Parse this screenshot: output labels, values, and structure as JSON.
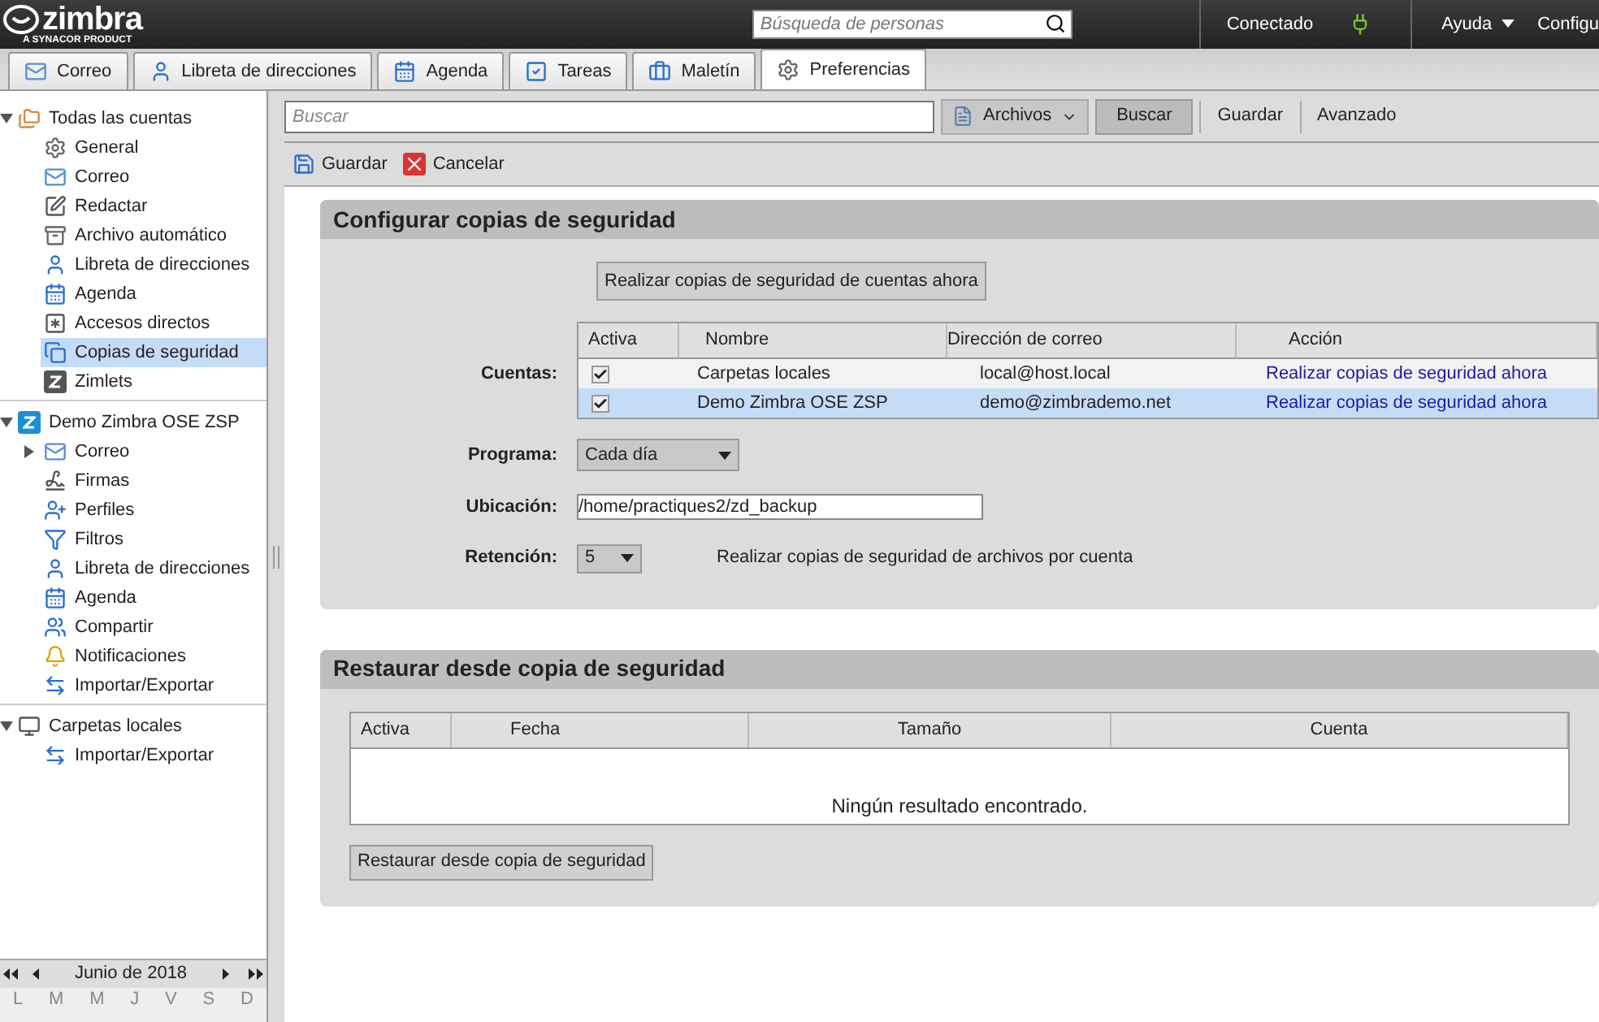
{
  "header": {
    "logo": "zimbra",
    "tagline": "A SYNACOR PRODUCT",
    "people_search": {
      "placeholder": "Búsqueda de personas"
    },
    "status": "Conectado",
    "help": "Ayuda",
    "settings": "Configu"
  },
  "tabs": [
    {
      "label": "Correo",
      "kind": "mail",
      "selected": false
    },
    {
      "label": "Libreta de direcciones",
      "kind": "contacts",
      "selected": false
    },
    {
      "label": "Agenda",
      "kind": "calendar",
      "selected": false
    },
    {
      "label": "Tareas",
      "kind": "tasks",
      "selected": false
    },
    {
      "label": "Maletín",
      "kind": "briefcase",
      "selected": false
    },
    {
      "label": "Preferencias",
      "kind": "gear",
      "selected": true
    }
  ],
  "sidebar": {
    "groups": [
      {
        "label": "Todas las cuentas",
        "kind": "accounts",
        "expanded": true,
        "children": [
          {
            "label": "General",
            "kind": "gear",
            "selected": false
          },
          {
            "label": "Correo",
            "kind": "mail",
            "selected": false
          },
          {
            "label": "Redactar",
            "kind": "compose",
            "selected": false
          },
          {
            "label": "Archivo automático",
            "kind": "archive",
            "selected": false
          },
          {
            "label": "Libreta de direcciones",
            "kind": "contacts",
            "selected": false
          },
          {
            "label": "Agenda",
            "kind": "calendar",
            "selected": false
          },
          {
            "label": "Accesos directos",
            "kind": "shortcut",
            "selected": false
          },
          {
            "label": "Copias de seguridad",
            "kind": "backup",
            "selected": true
          },
          {
            "label": "Zimlets",
            "kind": "zimlet",
            "selected": false
          }
        ]
      },
      {
        "label": "Demo Zimbra OSE ZSP",
        "kind": "zimbra",
        "expanded": true,
        "children": [
          {
            "label": "Correo",
            "kind": "mail",
            "selected": false,
            "expanded": false
          },
          {
            "label": "Firmas",
            "kind": "signature",
            "selected": false
          },
          {
            "label": "Perfiles",
            "kind": "persona",
            "selected": false
          },
          {
            "label": "Filtros",
            "kind": "filter",
            "selected": false
          },
          {
            "label": "Libreta de direcciones",
            "kind": "contacts",
            "selected": false
          },
          {
            "label": "Agenda",
            "kind": "calendar",
            "selected": false
          },
          {
            "label": "Compartir",
            "kind": "share",
            "selected": false
          },
          {
            "label": "Notificaciones",
            "kind": "bell",
            "selected": false
          },
          {
            "label": "Importar/Exportar",
            "kind": "import",
            "selected": false
          }
        ]
      },
      {
        "label": "Carpetas locales",
        "kind": "local",
        "expanded": true,
        "children": [
          {
            "label": "Importar/Exportar",
            "kind": "import",
            "selected": false
          }
        ]
      }
    ]
  },
  "mini_calendar": {
    "title": "Junio de 2018",
    "weekdays": [
      "L",
      "M",
      "M",
      "J",
      "V",
      "S",
      "D"
    ]
  },
  "search_bar": {
    "placeholder": "Buscar",
    "scope": "Archivos",
    "search": "Buscar",
    "save": "Guardar",
    "advanced": "Avanzado"
  },
  "toolbar": {
    "save": "Guardar",
    "cancel": "Cancelar"
  },
  "backup_section": {
    "title": "Configurar copias de seguridad",
    "backup_now": "Realizar copias de seguridad de cuentas ahora",
    "accounts_label": "Cuentas:",
    "columns": [
      "Activa",
      "Nombre",
      "Dirección de correo",
      "Acción"
    ],
    "rows": [
      {
        "checked": true,
        "name": "Carpetas locales",
        "email": "local@host.local",
        "action": "Realizar copias de seguridad ahora",
        "selected": false
      },
      {
        "checked": true,
        "name": "Demo Zimbra OSE ZSP",
        "email": "demo@zimbrademo.net",
        "action": "Realizar copias de seguridad ahora",
        "selected": true
      }
    ],
    "schedule_label": "Programa:",
    "schedule": "Cada día",
    "location_label": "Ubicación:",
    "location": "/home/practiques2/zd_backup",
    "retention_label": "Retención:",
    "retention": "5",
    "retention_note": "Realizar copias de seguridad de archivos por cuenta"
  },
  "restore_section": {
    "title": "Restaurar desde copia de seguridad",
    "columns": [
      "Activa",
      "Fecha",
      "Tamaño",
      "Cuenta"
    ],
    "empty": "Ningún resultado encontrado.",
    "restore": "Restaurar desde copia de seguridad"
  }
}
